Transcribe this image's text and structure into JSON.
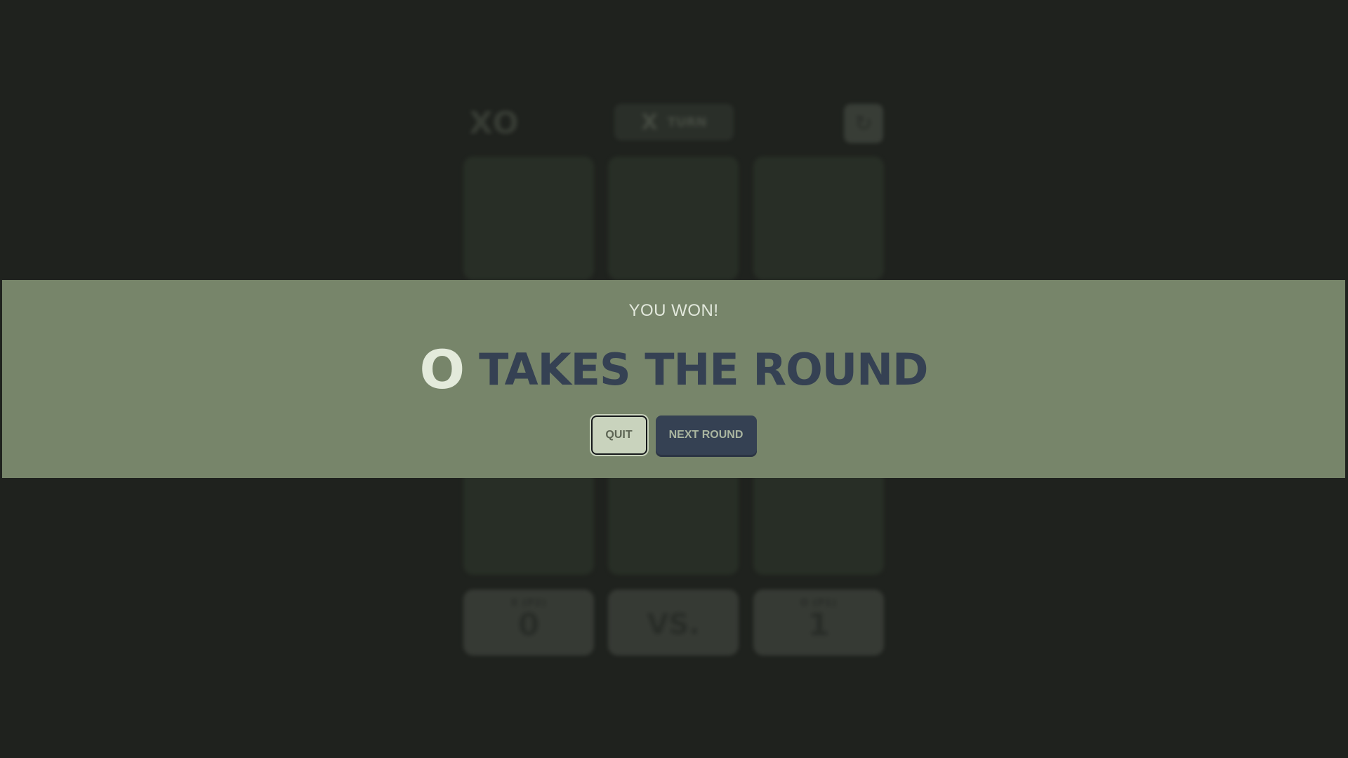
{
  "header": {
    "logo": "XO",
    "turn": {
      "mark": "X",
      "label": "TURN"
    },
    "restart_icon": "restart-icon"
  },
  "board": {
    "cells": [
      "",
      "",
      "",
      "",
      "",
      "",
      "",
      "",
      ""
    ]
  },
  "scores": [
    {
      "label": "X (P2)",
      "value": "0"
    },
    {
      "label": "",
      "value": "VS."
    },
    {
      "label": "O (P1)",
      "value": "1"
    }
  ],
  "result": {
    "status": "YOU WON!",
    "winner_mark": "O",
    "headline": "TAKES THE ROUND",
    "quit_label": "QUIT",
    "next_label": "NEXT ROUND"
  },
  "colors": {
    "background": "#1f221e",
    "banner": "#77856a",
    "headline": "#354153",
    "winner_mark": "#e3eadb",
    "quit_button": "#c9d3bd",
    "next_button": "#354153"
  }
}
